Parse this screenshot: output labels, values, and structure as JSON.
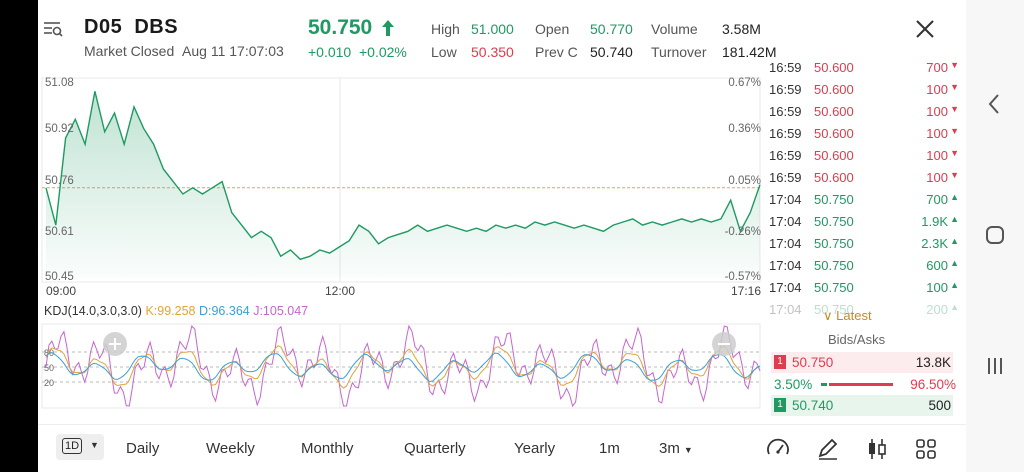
{
  "header": {
    "symbol": "D05",
    "name": "DBS",
    "status": "Market Closed",
    "timestamp": "Aug 11 17:07:03",
    "price": "50.750",
    "change": "+0.010",
    "change_pct": "+0.02%",
    "stats": {
      "high_label": "High",
      "high_value": "51.000",
      "low_label": "Low",
      "low_value": "50.350",
      "open_label": "Open",
      "open_value": "50.770",
      "prevc_label": "Prev C",
      "prevc_value": "50.740",
      "volume_label": "Volume",
      "volume_value": "3.58M",
      "turnover_label": "Turnover",
      "turnover_value": "181.42M"
    }
  },
  "chart": {
    "y_labels": [
      "51.08",
      "50.92",
      "50.76",
      "50.61",
      "50.45"
    ],
    "pct_labels": [
      "0.67%",
      "0.36%",
      "0.05%",
      "-0.26%",
      "-0.57%"
    ],
    "x_labels": [
      "09:00",
      "12:00",
      "17:16"
    ],
    "kdj_title": "KDJ(14.0,3.0,3.0)",
    "kdj_k": "K:99.258",
    "kdj_d": "D:96.364",
    "kdj_j": "J:105.047",
    "kdj_levels": [
      "80",
      "50",
      "20"
    ],
    "colors": {
      "up": "#1e9a62",
      "down": "#dd3d4f",
      "k": "#e3a33b",
      "d": "#3aa0d8",
      "j": "#c765d1"
    }
  },
  "chart_data": {
    "type": "line",
    "x_range": [
      "09:00",
      "17:16"
    ],
    "ylim": [
      50.45,
      51.08
    ],
    "prev_close": 50.74,
    "series": [],
    "points": [
      [
        0,
        50.74
      ],
      [
        1,
        50.62
      ],
      [
        2,
        50.9
      ],
      [
        3,
        50.96
      ],
      [
        4,
        50.88
      ],
      [
        5,
        51.05
      ],
      [
        6,
        50.92
      ],
      [
        7,
        50.98
      ],
      [
        8,
        50.88
      ],
      [
        9,
        51.0
      ],
      [
        10,
        50.93
      ],
      [
        11,
        50.88
      ],
      [
        12,
        50.8
      ],
      [
        13,
        50.76
      ],
      [
        14,
        50.72
      ],
      [
        15,
        50.74
      ],
      [
        16,
        50.72
      ],
      [
        17,
        50.74
      ],
      [
        18,
        50.76
      ],
      [
        19,
        50.66
      ],
      [
        20,
        50.62
      ],
      [
        21,
        50.58
      ],
      [
        22,
        50.6
      ],
      [
        23,
        50.58
      ],
      [
        24,
        50.52
      ],
      [
        25,
        50.54
      ],
      [
        26,
        50.51
      ],
      [
        27,
        50.52
      ],
      [
        28,
        50.54
      ],
      [
        29,
        50.53
      ],
      [
        30,
        50.55
      ],
      [
        31,
        50.57
      ],
      [
        32,
        50.62
      ],
      [
        33,
        50.6
      ],
      [
        34,
        50.56
      ],
      [
        35,
        50.58
      ],
      [
        36,
        50.59
      ],
      [
        37,
        50.6
      ],
      [
        38,
        50.62
      ],
      [
        39,
        50.6
      ],
      [
        40,
        50.61
      ],
      [
        41,
        50.62
      ],
      [
        42,
        50.61
      ],
      [
        43,
        50.6
      ],
      [
        44,
        50.61
      ],
      [
        45,
        50.6
      ],
      [
        46,
        50.62
      ],
      [
        47,
        50.61
      ],
      [
        48,
        50.62
      ],
      [
        49,
        50.61
      ],
      [
        50,
        50.63
      ],
      [
        51,
        50.62
      ],
      [
        52,
        50.63
      ],
      [
        53,
        50.62
      ],
      [
        54,
        50.61
      ],
      [
        55,
        50.62
      ],
      [
        56,
        50.61
      ],
      [
        57,
        50.6
      ],
      [
        58,
        50.62
      ],
      [
        59,
        50.63
      ],
      [
        60,
        50.64
      ],
      [
        61,
        50.62
      ],
      [
        62,
        50.63
      ],
      [
        63,
        50.62
      ],
      [
        64,
        50.63
      ],
      [
        65,
        50.64
      ],
      [
        66,
        50.63
      ],
      [
        67,
        50.64
      ],
      [
        68,
        50.63
      ],
      [
        69,
        50.64
      ],
      [
        70,
        50.7
      ],
      [
        71,
        50.6
      ],
      [
        72,
        50.66
      ],
      [
        73,
        50.75
      ]
    ]
  },
  "tape": [
    {
      "time": "16:59",
      "price": "50.600",
      "vol": "700",
      "dir": "down"
    },
    {
      "time": "16:59",
      "price": "50.600",
      "vol": "100",
      "dir": "down"
    },
    {
      "time": "16:59",
      "price": "50.600",
      "vol": "100",
      "dir": "down"
    },
    {
      "time": "16:59",
      "price": "50.600",
      "vol": "100",
      "dir": "down"
    },
    {
      "time": "16:59",
      "price": "50.600",
      "vol": "100",
      "dir": "down"
    },
    {
      "time": "16:59",
      "price": "50.600",
      "vol": "100",
      "dir": "down"
    },
    {
      "time": "17:04",
      "price": "50.750",
      "vol": "700",
      "dir": "up"
    },
    {
      "time": "17:04",
      "price": "50.750",
      "vol": "1.9K",
      "dir": "up"
    },
    {
      "time": "17:04",
      "price": "50.750",
      "vol": "2.3K",
      "dir": "up"
    },
    {
      "time": "17:04",
      "price": "50.750",
      "vol": "600",
      "dir": "up"
    },
    {
      "time": "17:04",
      "price": "50.750",
      "vol": "100",
      "dir": "up"
    },
    {
      "time": "17:04",
      "price": "50.750",
      "vol": "200",
      "dir": "up"
    }
  ],
  "latest_label": "Latest",
  "bidask": {
    "title": "Bids/Asks",
    "ask_level": "1",
    "ask_price": "50.750",
    "ask_size": "13.8K",
    "bid_pct": "3.50%",
    "ask_pct": "96.50%",
    "bid_level": "1",
    "bid_price": "50.740",
    "bid_size": "500"
  },
  "toolbar": {
    "interval": "1D",
    "tabs": [
      "Daily",
      "Weekly",
      "Monthly",
      "Quarterly",
      "Yearly",
      "1m",
      "3m"
    ],
    "icons": [
      "gauge-icon",
      "draw-icon",
      "candlestick-icon",
      "grid-icon"
    ]
  }
}
